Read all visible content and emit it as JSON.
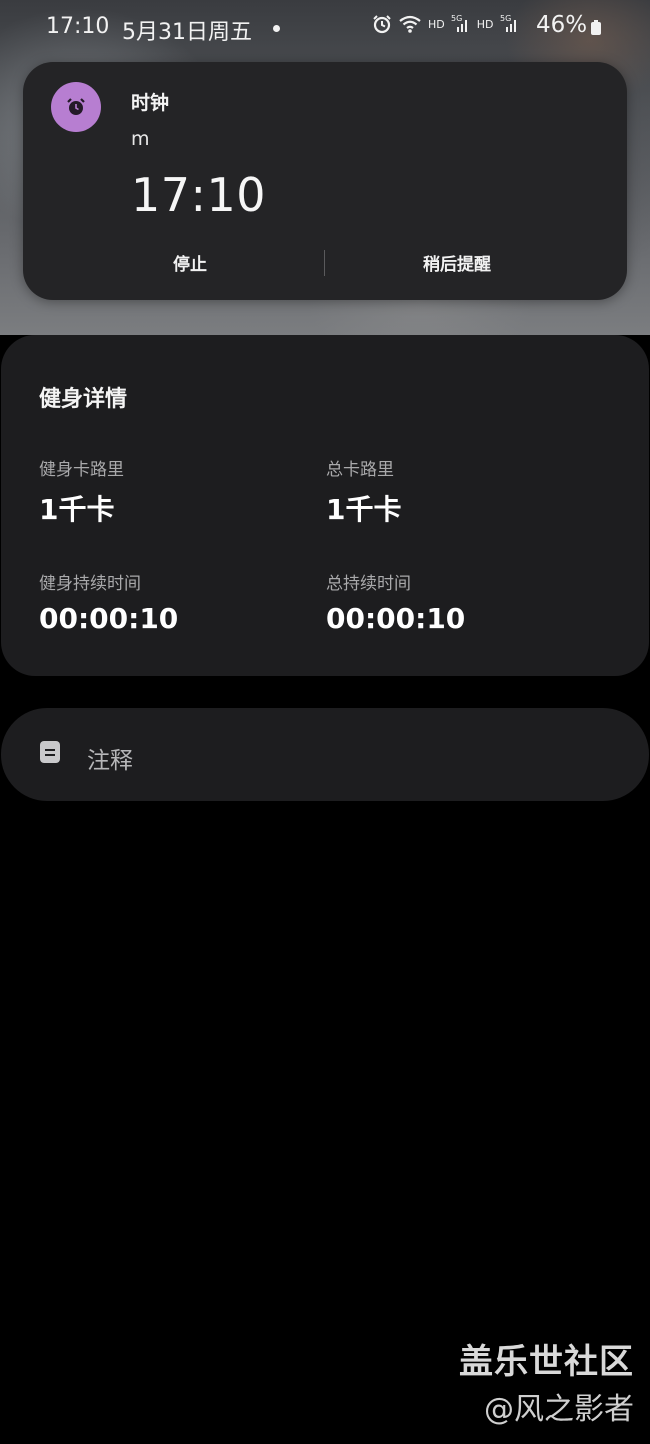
{
  "status_bar": {
    "time": "17:10",
    "date": "5月31日周五",
    "battery": "46%",
    "icons": [
      "alarm-icon",
      "wifi-icon",
      "signal-icon",
      "signal-icon",
      "battery-icon"
    ],
    "network_labels": [
      "HD",
      "5G",
      "HD",
      "5G"
    ]
  },
  "notification": {
    "app_name": "时钟",
    "subtitle": "m",
    "time": "17:10",
    "icon": "alarm-clock-icon",
    "icon_bg": "#b77ed1",
    "actions": {
      "stop": "停止",
      "snooze": "稍后提醒"
    }
  },
  "workout_details": {
    "title": "健身详情",
    "stats": [
      {
        "label": "健身卡路里",
        "value": "1千卡"
      },
      {
        "label": "总卡路里",
        "value": "1千卡"
      },
      {
        "label": "健身持续时间",
        "value": "00:00:10"
      },
      {
        "label": "总持续时间",
        "value": "00:00:10"
      }
    ]
  },
  "notes": {
    "label": "注释",
    "icon": "note-icon"
  },
  "watermark": {
    "main": "盖乐世社区",
    "sub": "@风之影者"
  }
}
